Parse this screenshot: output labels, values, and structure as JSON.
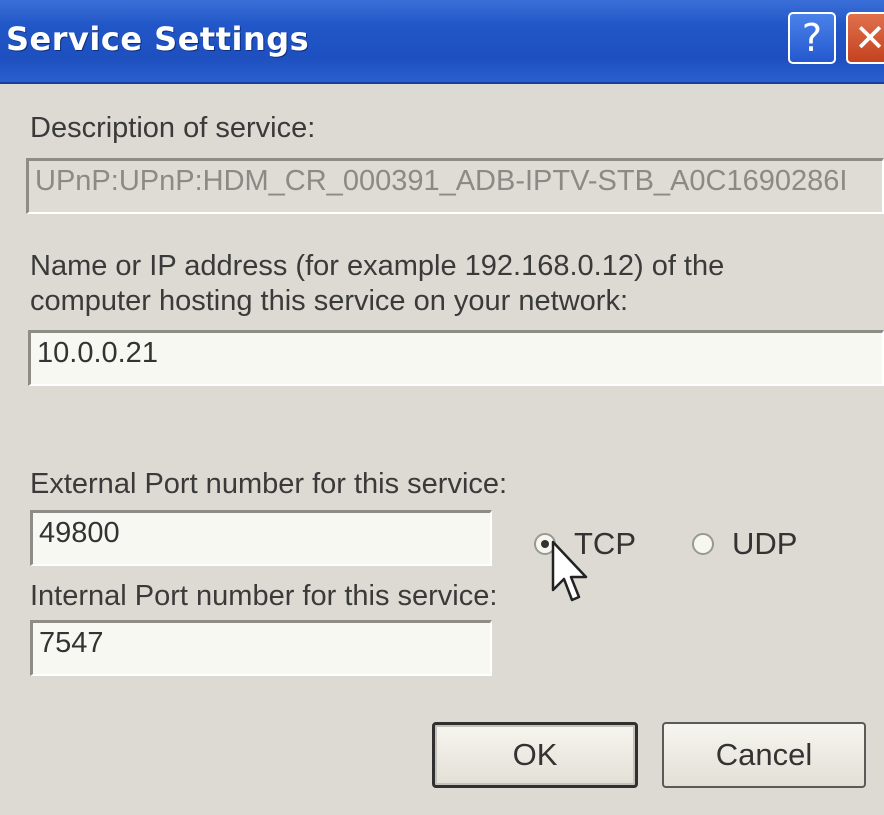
{
  "window": {
    "title": "Service Settings",
    "help_label": "?",
    "close_label": "✕"
  },
  "description": {
    "label": "Description of service:",
    "value": "UPnP:UPnP:HDM_CR_000391_ADB-IPTV-STB_A0C1690286I"
  },
  "host": {
    "label_line1": "Name or IP address (for example 192.168.0.12) of the",
    "label_line2": "computer hosting this service on your network:",
    "value": "10.0.0.21"
  },
  "external_port": {
    "label": "External Port number for this service:",
    "value": "49800"
  },
  "internal_port": {
    "label": "Internal Port number for this service:",
    "value": "7547"
  },
  "protocol": {
    "options": [
      {
        "label": "TCP",
        "selected": true
      },
      {
        "label": "UDP",
        "selected": false
      }
    ]
  },
  "buttons": {
    "ok": "OK",
    "cancel": "Cancel"
  },
  "colors": {
    "titlebar": "#2257c8",
    "dialog_bg": "#dcdad2"
  }
}
